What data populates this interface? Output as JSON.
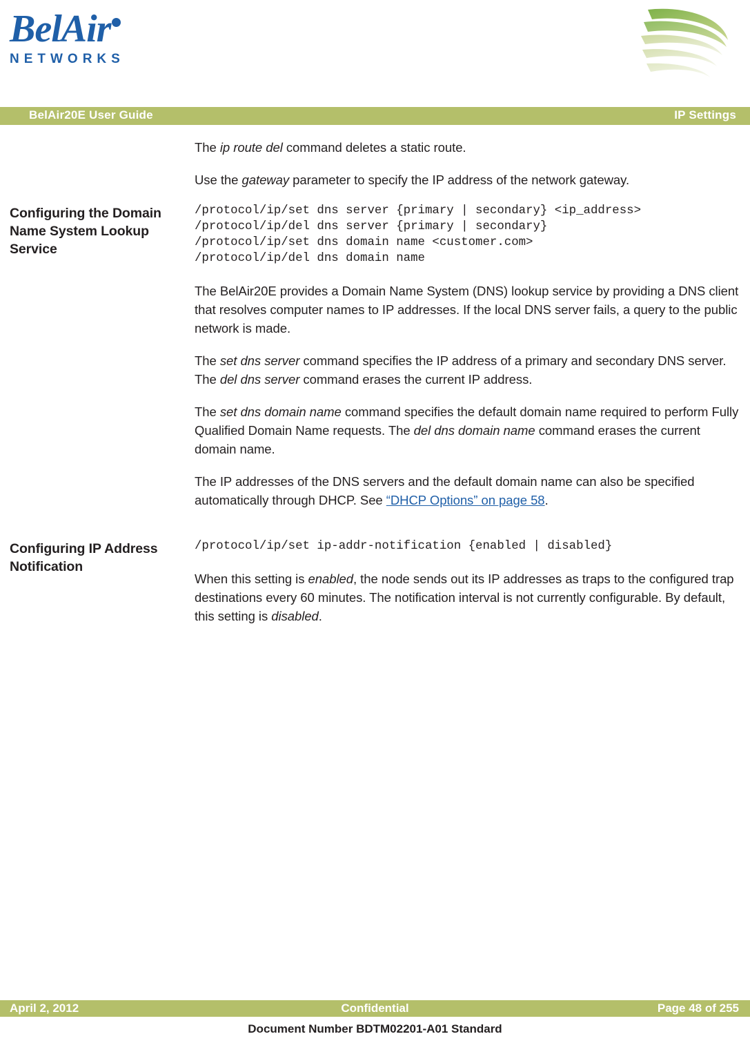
{
  "brand": {
    "logo_main": "BelAir",
    "logo_sub": "NETWORKS"
  },
  "running_head": {
    "left": "BelAir20E User Guide",
    "right": "IP Settings"
  },
  "intro": {
    "p1_before": "The ",
    "p1_italic": "ip route del",
    "p1_after": " command deletes a static route.",
    "p2_before": "Use the ",
    "p2_italic": "gateway",
    "p2_after": " parameter to specify the IP address of the network gateway."
  },
  "section_dns": {
    "margin_heading": "Configuring the Domain Name System Lookup Service",
    "code": "/protocol/ip/set dns server {primary | secondary} <ip_address>\n/protocol/ip/del dns server {primary | secondary}\n/protocol/ip/set dns domain name <customer.com>\n/protocol/ip/del dns domain name",
    "p1": "The BelAir20E provides a Domain Name System (DNS) lookup service by providing a DNS client that resolves computer names to IP addresses. If the local DNS server fails, a query to the public network is made.",
    "p2_a": "The ",
    "p2_i1": "set dns server",
    "p2_b": " command specifies the IP address of a primary and secondary DNS server. The ",
    "p2_i2": "del dns server",
    "p2_c": " command erases the current IP address.",
    "p3_a": "The ",
    "p3_i1": "set dns domain name",
    "p3_b": " command specifies the default domain name required to perform Fully Qualified Domain Name requests. The ",
    "p3_i2": "del dns domain name",
    "p3_c": " command erases the current domain name.",
    "p4_a": "The IP addresses of the DNS servers and the default domain name can also be specified automatically through DHCP. See ",
    "p4_link": "“DHCP Options” on page 58",
    "p4_b": "."
  },
  "section_ipaddr": {
    "margin_heading": "Configuring IP Address Notification",
    "code": "/protocol/ip/set ip-addr-notification {enabled | disabled}",
    "p1_a": "When this setting is ",
    "p1_i1": "enabled",
    "p1_b": ", the node sends out its IP addresses as traps to the configured trap destinations every 60 minutes. The notification interval is not currently configurable. By default, this setting is ",
    "p1_i2": "disabled",
    "p1_c": "."
  },
  "footer": {
    "date": "April 2, 2012",
    "classification": "Confidential",
    "page": "Page 48 of 255",
    "document_number": "Document Number BDTM02201-A01 Standard"
  },
  "colors": {
    "brand_blue": "#1f5fa8",
    "bar_green": "#b4bf6a",
    "link_blue": "#1f5fa8"
  }
}
